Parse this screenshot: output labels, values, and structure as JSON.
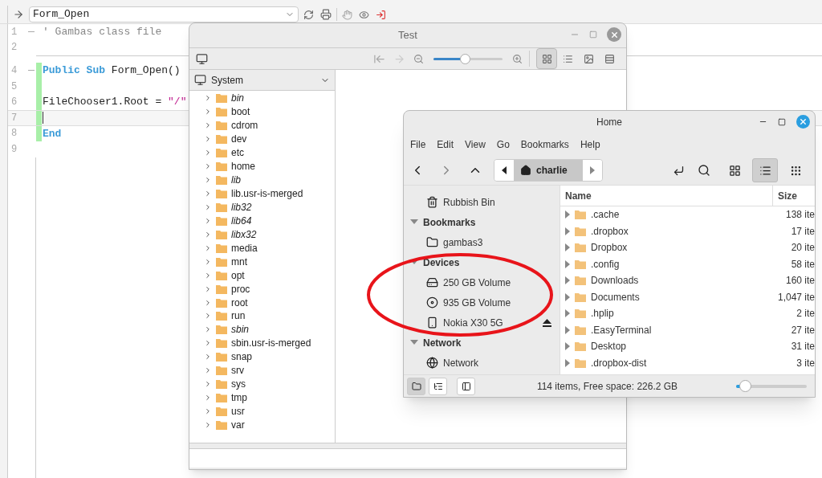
{
  "editor": {
    "procedure": "Form_Open",
    "lines": [
      {
        "number": "1",
        "foldable": true,
        "modified": false,
        "current": false,
        "segments": [
          {
            "text": "' Gambas class file",
            "kind": "comment"
          }
        ]
      },
      {
        "number": "2",
        "foldable": false,
        "modified": false,
        "current": false
      },
      {
        "number": "4",
        "foldable": true,
        "modified": true,
        "current": false,
        "segments": [
          {
            "text": "Public",
            "kind": "keyword"
          },
          {
            "text": " Sub",
            "kind": "keyword"
          },
          {
            "text": " Form_Open()",
            "kind": "plain"
          }
        ]
      },
      {
        "number": "5",
        "foldable": false,
        "modified": true,
        "current": false
      },
      {
        "number": "6",
        "foldable": false,
        "modified": true,
        "current": false,
        "segments": [
          {
            "text": "FileChooser1.Root = ",
            "kind": "plain"
          },
          {
            "text": "\"/\"",
            "kind": "string"
          }
        ]
      },
      {
        "number": "7",
        "foldable": false,
        "modified": true,
        "current": true
      },
      {
        "number": "8",
        "foldable": false,
        "modified": true,
        "current": false,
        "segments": [
          {
            "text": "End",
            "kind": "keyword"
          }
        ]
      },
      {
        "number": "9",
        "foldable": false,
        "modified": false,
        "current": false
      }
    ]
  },
  "test_window": {
    "title": "Test",
    "zoom": {
      "level": 0.45
    },
    "views": [
      {
        "selected": true
      },
      {
        "selected": false
      },
      {
        "selected": false
      },
      {
        "selected": false
      }
    ],
    "root": "System",
    "tree": [
      {
        "name": "bin",
        "symlink": true
      },
      {
        "name": "boot",
        "symlink": false
      },
      {
        "name": "cdrom",
        "symlink": false
      },
      {
        "name": "dev",
        "symlink": false
      },
      {
        "name": "etc",
        "symlink": false
      },
      {
        "name": "home",
        "symlink": false
      },
      {
        "name": "lib",
        "symlink": true
      },
      {
        "name": "lib.usr-is-merged",
        "symlink": false
      },
      {
        "name": "lib32",
        "symlink": true
      },
      {
        "name": "lib64",
        "symlink": true
      },
      {
        "name": "libx32",
        "symlink": true
      },
      {
        "name": "media",
        "symlink": false
      },
      {
        "name": "mnt",
        "symlink": false
      },
      {
        "name": "opt",
        "symlink": false
      },
      {
        "name": "proc",
        "symlink": false
      },
      {
        "name": "root",
        "symlink": false
      },
      {
        "name": "run",
        "symlink": false
      },
      {
        "name": "sbin",
        "symlink": true
      },
      {
        "name": "sbin.usr-is-merged",
        "symlink": false
      },
      {
        "name": "snap",
        "symlink": false
      },
      {
        "name": "srv",
        "symlink": false
      },
      {
        "name": "sys",
        "symlink": false
      },
      {
        "name": "tmp",
        "symlink": false
      },
      {
        "name": "usr",
        "symlink": false
      },
      {
        "name": "var",
        "symlink": false
      }
    ]
  },
  "home_window": {
    "title": "Home",
    "menu": [
      "File",
      "Edit",
      "View",
      "Go",
      "Bookmarks",
      "Help"
    ],
    "path": "charlie",
    "views": [
      {
        "kind": "icons",
        "selected": false
      },
      {
        "kind": "list",
        "selected": true
      },
      {
        "kind": "compact",
        "selected": false
      }
    ],
    "sidebar": [
      {
        "kind": "trash",
        "label": "Rubbish Bin",
        "eject": false
      },
      {
        "kind": "section",
        "label": "Bookmarks",
        "expanded": true
      },
      {
        "kind": "bookmark",
        "label": "gambas3",
        "eject": false
      },
      {
        "kind": "section",
        "label": "Devices",
        "expanded": true
      },
      {
        "kind": "drive",
        "label": "250 GB Volume",
        "eject": false
      },
      {
        "kind": "disk",
        "label": "935 GB Volume",
        "eject": false
      },
      {
        "kind": "phone",
        "label": "Nokia X30 5G",
        "eject": true
      },
      {
        "kind": "section",
        "label": "Network",
        "expanded": true
      },
      {
        "kind": "network",
        "label": "Network",
        "eject": false
      }
    ],
    "columns": [
      "Name",
      "Size"
    ],
    "rows": [
      {
        "name": ".cache",
        "size": "138 ite"
      },
      {
        "name": ".dropbox",
        "size": "17 ite"
      },
      {
        "name": "Dropbox",
        "size": "20 ite"
      },
      {
        "name": ".config",
        "size": "58 ite"
      },
      {
        "name": "Downloads",
        "size": "160 ite"
      },
      {
        "name": "Documents",
        "size": "1,047 ite"
      },
      {
        "name": ".hplip",
        "size": "2 ite"
      },
      {
        "name": ".EasyTerminal",
        "size": "27 ite"
      },
      {
        "name": "Desktop",
        "size": "31 ite"
      },
      {
        "name": ".dropbox-dist",
        "size": "3 ite"
      }
    ],
    "pane_buttons": [
      {
        "kind": "places",
        "selected": true
      },
      {
        "kind": "tree",
        "selected": false
      },
      {
        "kind": "toggle",
        "selected": false
      }
    ],
    "status": "114 items, Free space: 226.2 GB",
    "zoom": {
      "level": 0.08
    }
  }
}
